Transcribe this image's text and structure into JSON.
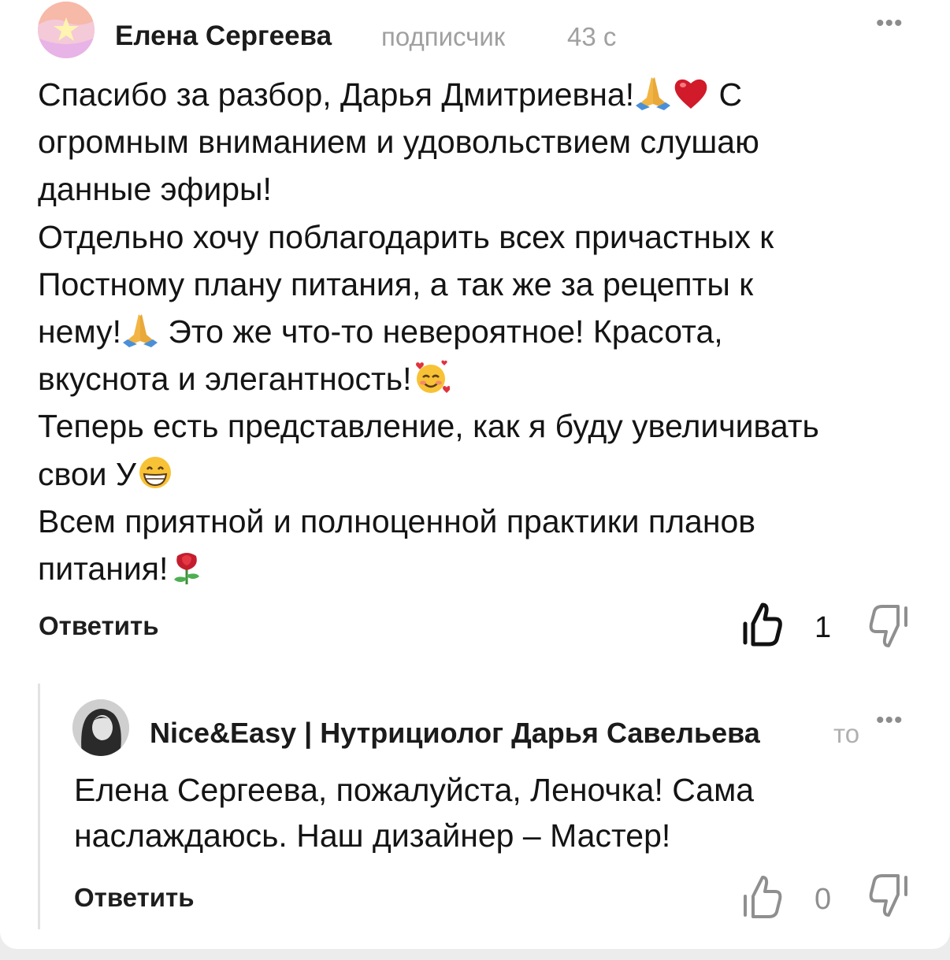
{
  "comment": {
    "author": "Елена Сергеева",
    "role": "подписчик",
    "time": "43 с",
    "more": "•••",
    "lines": [
      "Спасибо за разбор, Дарья Дмитриевна!",
      "огромным вниманием и удовольствием слушаю",
      "данные эфиры!",
      "Отдельно хочу поблагодарить всех причастных к",
      "Постному плану питания, а так же за рецепты к",
      "нему!",
      "вкуснота и элегантность!",
      "Теперь есть представление, как я буду увеличивать",
      "свои У",
      "Всем приятной и полноценной практики планов",
      "питания!"
    ],
    "line1_tail": "С",
    "line6_tail": "Это же что-то невероятное! Красота,",
    "reply_label": "Ответить",
    "likes": "1",
    "emoji": [
      "folded-hands",
      "red-heart",
      "smiling-face-with-hearts",
      "grinning-face",
      "rose"
    ]
  },
  "reply": {
    "author": "Nice&Easy | Нутрициолог Дарья Савельева",
    "meta_truncated": "то",
    "more": "•••",
    "lines": [
      "Елена Сергеева, пожалуйста, Леночка! Сама",
      "наслаждаюсь. Наш дизайнер – Мастер!"
    ],
    "reply_label": "Ответить",
    "likes": "0"
  },
  "colors": {
    "background": "#ffffff",
    "page_bg": "#ececec",
    "text": "#141414",
    "muted": "#a0a0a0",
    "thread_line": "#e3e3e3"
  }
}
